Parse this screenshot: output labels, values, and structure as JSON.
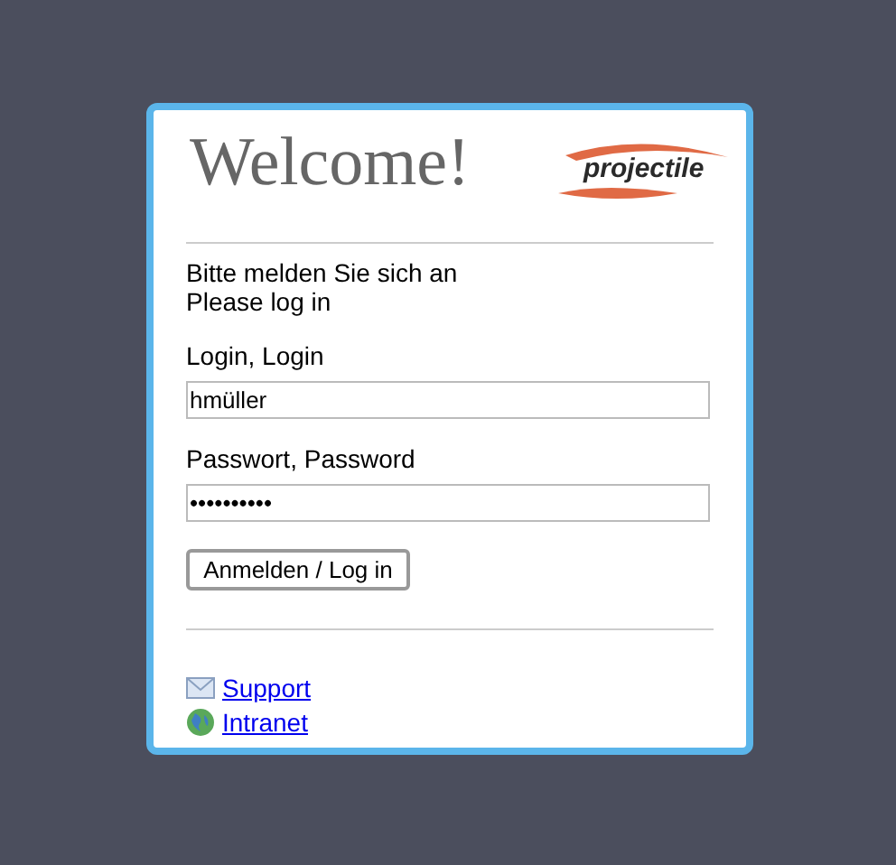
{
  "title": "Welcome!",
  "logo": {
    "text": "projectile"
  },
  "intro": [
    "Bitte melden Sie sich an",
    "Please log in"
  ],
  "fields": [
    {
      "label": "Login, Login",
      "value": "hmüller"
    },
    {
      "label": "Passwort, Password",
      "value": "••••••••••"
    }
  ],
  "button": "Anmelden / Log in",
  "links": [
    {
      "kind": "mail",
      "label": "Support"
    },
    {
      "kind": "globe",
      "label": "Intranet"
    }
  ]
}
